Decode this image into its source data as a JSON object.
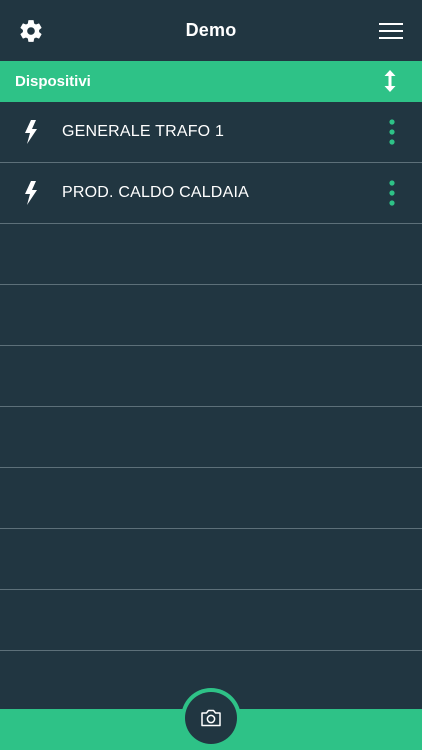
{
  "header": {
    "title": "Demo",
    "settings_icon": "gear-icon",
    "menu_icon": "hamburger-menu-icon"
  },
  "section": {
    "label": "Dispositivi",
    "sort_icon": "up-down-arrow-icon"
  },
  "devices": [
    {
      "name": "GENERALE TRAFO 1",
      "icon": "lightning-bolt-icon"
    },
    {
      "name": "PROD. CALDO CALDAIA",
      "icon": "lightning-bolt-icon"
    }
  ],
  "empty_rows": 8,
  "footer": {
    "camera_icon": "camera-icon"
  },
  "colors": {
    "background": "#213641",
    "accent": "#2ec287",
    "divider": "#5d7079",
    "text": "#ffffff"
  }
}
